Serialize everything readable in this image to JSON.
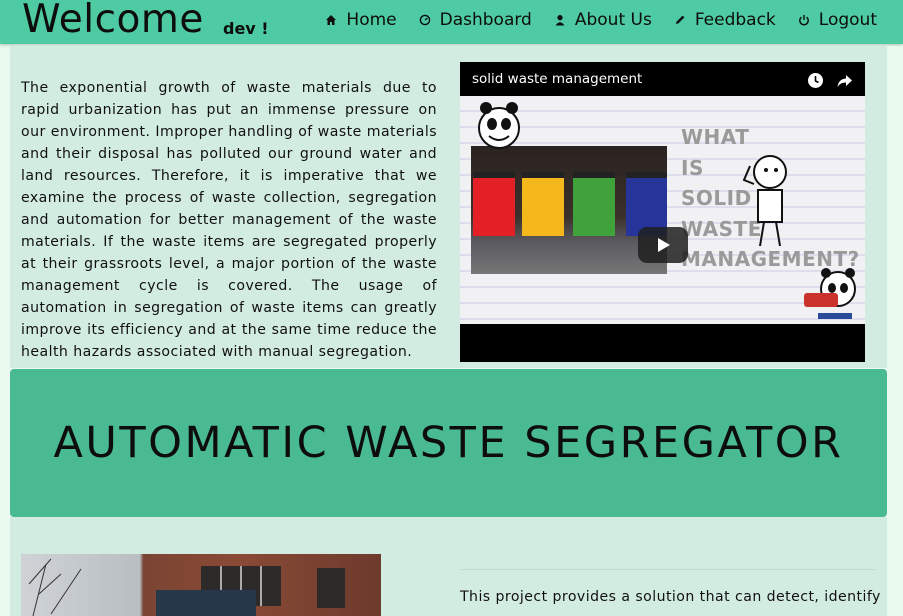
{
  "header": {
    "brand": "Welcome",
    "brand_sub": "dev !",
    "nav": [
      {
        "label": "Home",
        "icon": "home-icon"
      },
      {
        "label": "Dashboard",
        "icon": "dashboard-icon"
      },
      {
        "label": "About Us",
        "icon": "user-icon"
      },
      {
        "label": "Feedback",
        "icon": "pencil-icon"
      },
      {
        "label": "Logout",
        "icon": "power-icon"
      }
    ]
  },
  "intro": {
    "paragraph": "The exponential growth of waste materials due to rapid urbanization has put an immense pressure on our environment. Improper handling of waste materials and their disposal has polluted our ground water and land resources. Therefore, it is imperative that we examine the process of waste collection, segregation and automation for better management of the waste materials. If the waste items are segregated properly at their grassroots level, a major portion of the waste management cycle is covered. The usage of automation in segregation of waste items can greatly improve its efficiency and at the same time reduce the health hazards associated with manual segregation."
  },
  "video": {
    "title": "solid waste management",
    "thumbnail_words": [
      "WHAT",
      "IS",
      "SOLID",
      "WASTE",
      "MANAGEMENT?"
    ]
  },
  "banner": {
    "title": "AUTOMATIC WASTE SEGREGATOR"
  },
  "lower": {
    "paragraph_start": "This project provides a solution that can detect, identify"
  },
  "colors": {
    "navbar": "#4ecba3",
    "banner": "#49ba91",
    "section_bg": "#d3ece1",
    "page_bg": "#e9fbee"
  }
}
